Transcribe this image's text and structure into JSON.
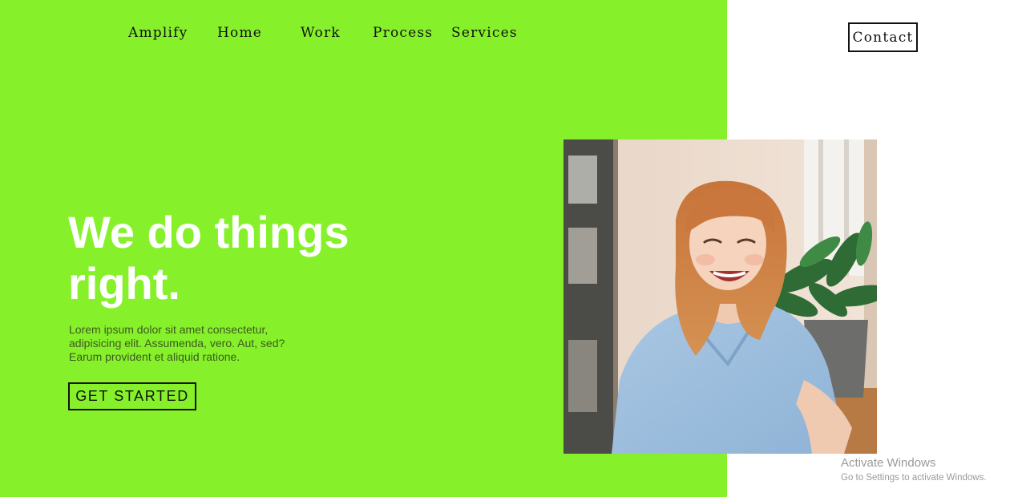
{
  "nav": {
    "items": [
      {
        "label": "Amplify"
      },
      {
        "label": "Home"
      },
      {
        "label": "Work"
      },
      {
        "label": "Process"
      },
      {
        "label": "Services"
      }
    ],
    "contact_label": "Contact"
  },
  "hero": {
    "title_line1": "We do things",
    "title_line2": "right.",
    "description": "Lorem ipsum dolor sit amet consectetur, adipisicing elit. Assumenda, vero. Aut, sed? Earum provident et aliquid ratione.",
    "cta_label": "GET STARTED"
  },
  "photo": {
    "icon": "smiling-woman-portrait-photo"
  },
  "watermark": {
    "title": "Activate Windows",
    "subtitle": "Go to Settings to activate Windows."
  },
  "colors": {
    "accent_green": "#86f12b",
    "hero_text": "#ffffff",
    "body_text": "#3c5a1e",
    "ink": "#111111"
  }
}
